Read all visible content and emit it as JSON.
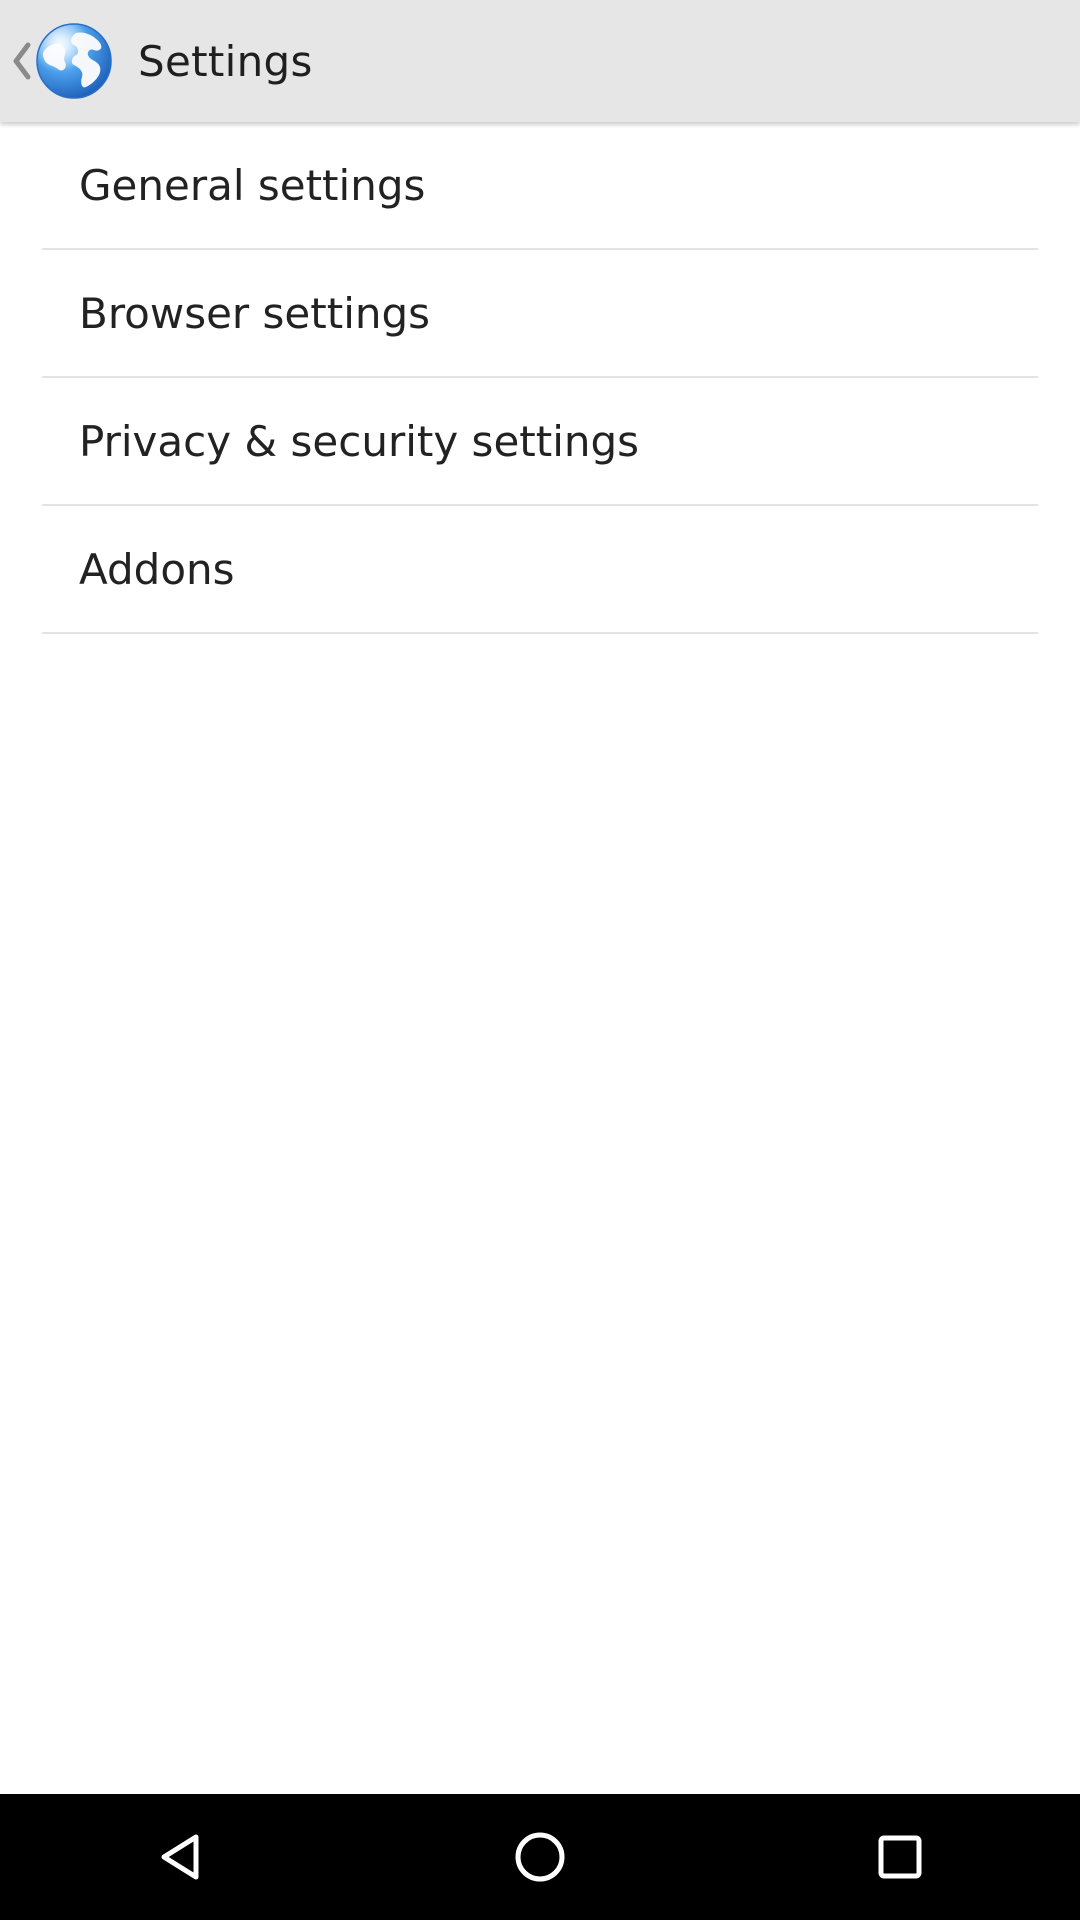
{
  "action_bar": {
    "title": "Settings",
    "up_icon": "chevron-left-icon",
    "logo_icon": "globe-icon"
  },
  "settings_list": {
    "items": [
      {
        "label": "General settings"
      },
      {
        "label": "Browser settings"
      },
      {
        "label": "Privacy & security settings"
      },
      {
        "label": "Addons"
      }
    ]
  },
  "nav_bar": {
    "back_icon": "triangle-back-icon",
    "home_icon": "circle-home-icon",
    "recents_icon": "square-recents-icon"
  },
  "colors": {
    "action_bar_bg": "#e6e6e6",
    "divider": "#e3e3e3",
    "text": "#222222",
    "nav_bar_bg": "#000000"
  }
}
